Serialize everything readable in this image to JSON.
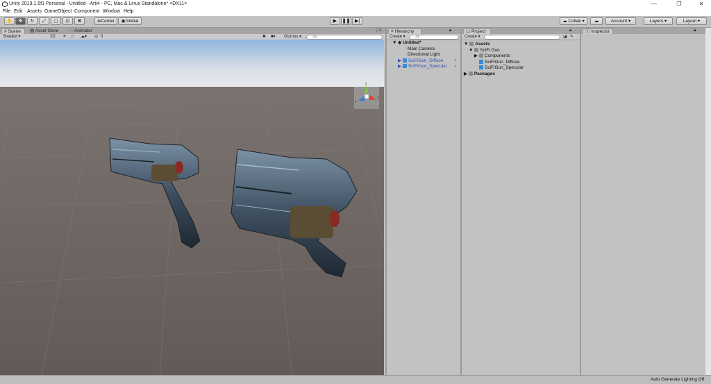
{
  "window": {
    "title": "Unity 2019.1.5f1 Personal - Untitled - Arti4 - PC, Mac & Linux Standalone* <DX11>",
    "minimize": "—",
    "maximize": "❐",
    "close": "✕"
  },
  "menu": [
    "File",
    "Edit",
    "Assets",
    "GameObject",
    "Component",
    "Window",
    "Help"
  ],
  "toolbar": {
    "tools": [
      "hand-tool",
      "move-tool",
      "rotate-tool",
      "scale-tool",
      "rect-tool",
      "transform-tool",
      "custom-tool"
    ],
    "pivot_label": "Center",
    "space_label": "Global",
    "collab_label": "Collab",
    "account_label": "Account",
    "layers_label": "Layers",
    "layout_label": "Layout"
  },
  "scene_tabs": [
    "Scene",
    "Asset Store",
    "Animator"
  ],
  "scene_toolbar": {
    "shading": "Shaded",
    "mode_2d": "2D",
    "hidden_count": "0",
    "gizmos": "Gizmos",
    "search_placeholder": "All"
  },
  "scene_gizmo": {
    "y_axis": "y",
    "x_axis": "x",
    "z_axis": "z"
  },
  "hierarchy": {
    "tab": "Hierarchy",
    "create": "Create",
    "search_placeholder": "All",
    "scene_name": "Untitled*",
    "items": [
      {
        "label": "Main Camera",
        "prefab": false
      },
      {
        "label": "Directional Light",
        "prefab": false
      },
      {
        "label": "SciFiGun_Diffuse",
        "prefab": true
      },
      {
        "label": "SciFiGun_Specular",
        "prefab": true
      }
    ]
  },
  "project": {
    "tab": "Project",
    "create": "Create",
    "tree": [
      {
        "label": "Assets",
        "bold": true,
        "depth": 0
      },
      {
        "label": "SciFi Gun",
        "bold": false,
        "depth": 1
      },
      {
        "label": "Components",
        "bold": false,
        "depth": 2
      },
      {
        "label": "SciFiGun_Diffuse",
        "bold": false,
        "depth": 2
      },
      {
        "label": "SciFiGun_Specular",
        "bold": false,
        "depth": 2
      },
      {
        "label": "Packages",
        "bold": true,
        "depth": 0
      }
    ]
  },
  "inspector": {
    "tab": "Inspector"
  },
  "status": {
    "lighting": "Auto Generate Lighting Off"
  },
  "colors": {
    "accent_blue": "#3a8ad8",
    "prefab_text": "#2d4fb0",
    "sky_top": "#9bbde0",
    "ground": "#6b6360"
  }
}
